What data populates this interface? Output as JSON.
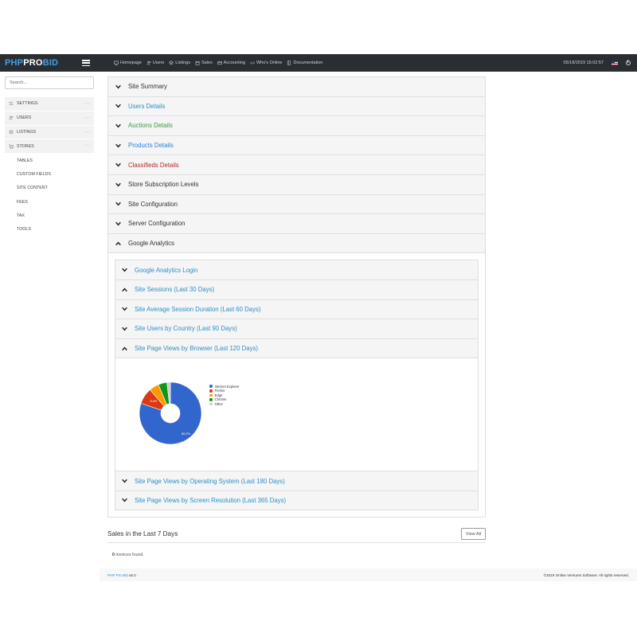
{
  "header": {
    "logo_part1": "PHP",
    "logo_part2": "PRO",
    "logo_part3": "BID",
    "nav": [
      {
        "label": "Homepage",
        "icon": "monitor-icon"
      },
      {
        "label": "Users",
        "icon": "users-icon"
      },
      {
        "label": "Listings",
        "icon": "layers-icon"
      },
      {
        "label": "Sales",
        "icon": "calendar-icon"
      },
      {
        "label": "Accounting",
        "icon": "wallet-icon"
      },
      {
        "label": "Who's Online",
        "icon": "signal-icon"
      },
      {
        "label": "Documentation",
        "icon": "book-icon"
      }
    ],
    "datetime": "05/18/2019 15:02:57",
    "flag_icon": "us-flag-icon",
    "power_icon": "power-icon"
  },
  "sidebar": {
    "search_placeholder": "Search...",
    "items": [
      {
        "label": "SETTINGS",
        "icon": "sliders-icon"
      },
      {
        "label": "USERS",
        "icon": "users-icon"
      },
      {
        "label": "LISTINGS",
        "icon": "layers-icon"
      },
      {
        "label": "STORES",
        "icon": "cart-icon"
      }
    ],
    "subitems": [
      "TABLES",
      "CUSTOM FIELDS",
      "SITE CONTENT",
      "FEES",
      "TAX",
      "TOOLS"
    ],
    "more_label": "···"
  },
  "panels": [
    {
      "label": "Site Summary",
      "color": "#333333"
    },
    {
      "label": "Users Details",
      "color": "#2c8fc9"
    },
    {
      "label": "Auctions Details",
      "color": "#3a9a3a"
    },
    {
      "label": "Products Details",
      "color": "#2b7fe0"
    },
    {
      "label": "Classifieds Details",
      "color": "#b02a2a"
    },
    {
      "label": "Store Subscription Levels",
      "color": "#333333"
    },
    {
      "label": "Site Configuration",
      "color": "#333333"
    },
    {
      "label": "Server Configuration",
      "color": "#333333"
    },
    {
      "label": "Google Analytics",
      "color": "#333333"
    }
  ],
  "analytics": {
    "subpanels": [
      "Google Analytics Login",
      "Site Sessions (Last 30 Days)",
      "Site Average Session Duration (Last 60 Days)",
      "Site Users by Country (Last 90 Days)",
      "Site Page Views by Browser (Last 120 Days)"
    ],
    "after_chart": [
      "Site Page Views by Operating System (Last 180 Days)",
      "Site Page Views by Screen Resolution (Last 365 Days)"
    ]
  },
  "chart_data": {
    "type": "pie",
    "donut": true,
    "categories": [
      "Internet Explorer",
      "Firefox",
      "Edge",
      "Chrome",
      "Other"
    ],
    "values": [
      80.2,
      8.4,
      5.1,
      4.5,
      1.8
    ],
    "colors": [
      "#3366cc",
      "#dc3912",
      "#ff9900",
      "#109618",
      "#cccccc"
    ],
    "slice_labels": [
      "80.2%",
      "8.4%",
      "",
      "",
      ""
    ],
    "legend_position": "right"
  },
  "sales": {
    "title": "Sales in the Last 7 Days",
    "view_all": "View All",
    "count": "0",
    "empty_text": "invoices found."
  },
  "footer": {
    "brand": "PHP Pro Bid",
    "version": "v8.0",
    "copyright": "©2019 Online Ventures Software. All rights reserved."
  }
}
